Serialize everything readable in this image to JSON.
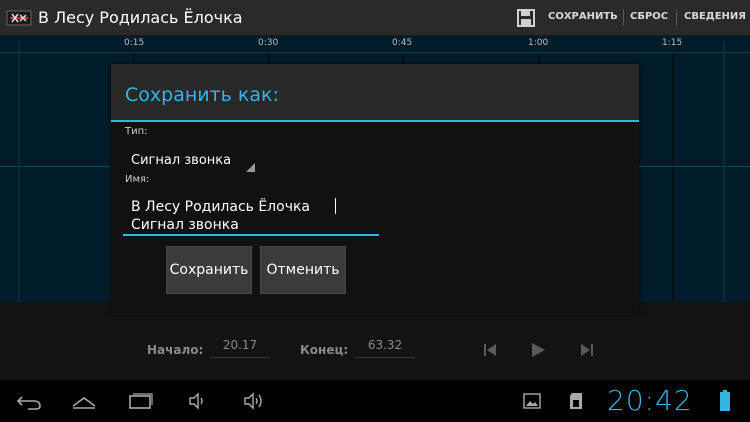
{
  "action_bar": {
    "title": "В Лесу Родилась Ёлочка",
    "save_label": "СОХРАНИТЬ",
    "reset_label": "СБРОС",
    "info_label": "СВЕДЕНИЯ",
    "icons": [
      "app-scissors-icon",
      "save-disk-icon"
    ]
  },
  "waveform": {
    "ticks": [
      "0:15",
      "0:30",
      "0:45",
      "1:00",
      "1:15"
    ]
  },
  "controls": {
    "start_label": "Начало:",
    "start_value": "20.17",
    "end_label": "Конец:",
    "end_value": "63.32",
    "icons": [
      "skip-back-icon",
      "play-icon",
      "skip-forward-icon"
    ]
  },
  "dialog": {
    "title": "Сохранить как:",
    "type_label": "Тип:",
    "type_value": "Сигнал звонка",
    "name_label": "Имя:",
    "name_value": "В Лесу Родилась Ёлочка\nСигнал звонка",
    "save_button": "Сохранить",
    "cancel_button": "Отменить"
  },
  "nav_bar": {
    "icons": [
      "back-icon",
      "home-icon",
      "recent-apps-icon",
      "volume-down-icon",
      "volume-up-icon",
      "screenshot-icon",
      "sd-card-icon",
      "battery-icon"
    ],
    "clock": "20:42"
  },
  "colors": {
    "accent": "#33b5e5",
    "action_bar_bg": "#2a2a2a",
    "dialog_bg": "#282828"
  }
}
